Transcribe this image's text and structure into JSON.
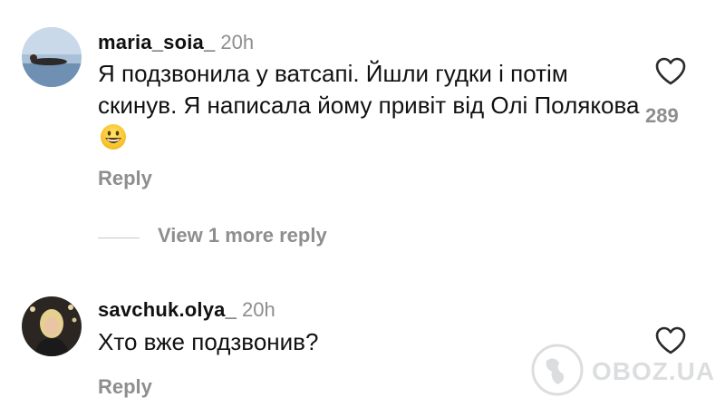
{
  "comments": [
    {
      "username": "maria_soia_",
      "timestamp": "20h",
      "text": "Я подзвонила у ватсапі. Йшли гудки і потім скинув. Я написала йому привіт від Олі Полякова",
      "emoji": "grinning-face-emoji",
      "likes": "289",
      "reply_label": "Reply"
    },
    {
      "username": "savchuk.olya_",
      "timestamp": "20h",
      "text": "Хто вже подзвонив?",
      "reply_label": "Reply"
    }
  ],
  "view_more_label": "View 1 more reply",
  "watermark": "OBOZ.UA",
  "icons": {
    "like": "heart-outline-icon"
  },
  "colors": {
    "text": "#111111",
    "secondary": "#8e8e8e"
  }
}
